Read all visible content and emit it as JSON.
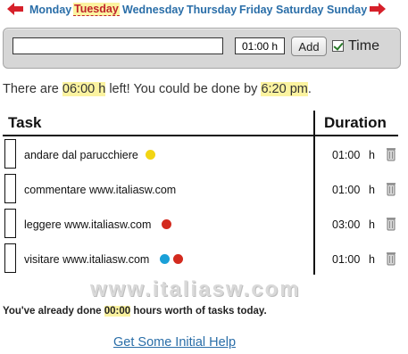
{
  "day_nav": {
    "prev_icon": "left-arrow-icon",
    "next_icon": "right-arrow-icon",
    "arrow_color": "#d6202a",
    "days": [
      "Monday",
      "Tuesday",
      "Wednesday",
      "Thursday",
      "Friday",
      "Saturday",
      "Sunday"
    ],
    "selected": "Tuesday"
  },
  "input_bar": {
    "task_value": "",
    "time_value": "01:00 h",
    "add_label": "Add",
    "time_label": "Time",
    "time_checked": true
  },
  "summary": {
    "prefix": "There are ",
    "hours_left": "06:00 h",
    "middle": " left! You could be done by ",
    "done_by": "6:20 pm",
    "suffix": "."
  },
  "table": {
    "task_header": "Task",
    "duration_header": "Duration",
    "rows": [
      {
        "name": "andare dal parucchiere",
        "tags": [
          "#f2d513"
        ],
        "duration": "01:00",
        "unit": "h"
      },
      {
        "name": "commentare www.italiasw.com",
        "tags": [],
        "duration": "01:00",
        "unit": "h"
      },
      {
        "name": "leggere www.italiasw.com",
        "tags": [
          "#d32a1e"
        ],
        "duration": "03:00",
        "unit": "h"
      },
      {
        "name": "visitare www.italiasw.com",
        "tags": [
          "#1aa0d8",
          "#d32a1e"
        ],
        "duration": "01:00",
        "unit": "h"
      }
    ]
  },
  "watermark": "www.italiasw.com",
  "done_today": {
    "prefix": "You've already done ",
    "hours": "00:00",
    "suffix": " hours worth of tasks today."
  },
  "help_link": "Get Some Initial Help",
  "colors": {
    "link": "#2a6ea8",
    "highlight": "#fbf3a0",
    "active_day": "#c0242b"
  }
}
